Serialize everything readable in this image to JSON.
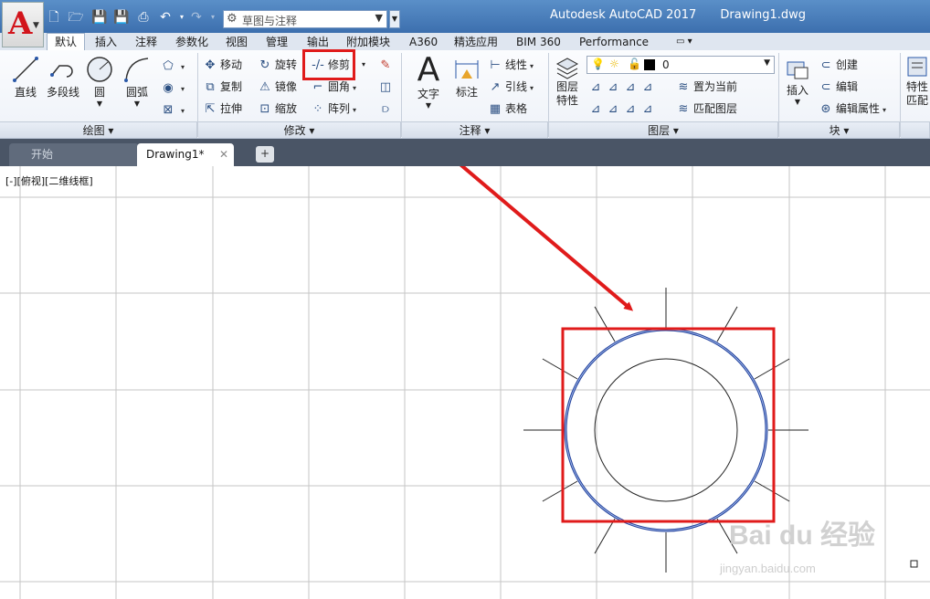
{
  "app": {
    "title": "Autodesk AutoCAD 2017",
    "document": "Drawing1.dwg"
  },
  "workspace": {
    "label": "草图与注释"
  },
  "ribbon_tabs": [
    "默认",
    "插入",
    "注释",
    "参数化",
    "视图",
    "管理",
    "输出",
    "附加模块",
    "A360",
    "精选应用",
    "BIM 360",
    "Performance"
  ],
  "panels": {
    "draw": {
      "title": "绘图",
      "line": "直线",
      "polyline": "多段线",
      "circle": "圆",
      "arc": "圆弧"
    },
    "modify": {
      "title": "修改",
      "move": "移动",
      "rotate": "旋转",
      "trim": "修剪",
      "copy": "复制",
      "mirror": "镜像",
      "fillet": "圆角",
      "stretch": "拉伸",
      "scale": "缩放",
      "array": "阵列"
    },
    "annotation": {
      "title": "注释",
      "text": "文字",
      "dimension": "标注",
      "linear": "线性",
      "leader": "引线",
      "table": "表格"
    },
    "layers": {
      "title": "图层",
      "properties_line1": "图层",
      "properties_line2": "特性",
      "current_layer": "0",
      "set_current": "置为当前",
      "match_layer": "匹配图层"
    },
    "block": {
      "title": "块",
      "insert": "插入",
      "create": "创建",
      "edit": "编辑",
      "edit_attributes": "编辑属性"
    },
    "properties": {
      "line1": "特性",
      "line2": "匹配"
    }
  },
  "doc_tabs": [
    "开始",
    "Drawing1*"
  ],
  "viewport_label": "[-][俯视][二维线框]",
  "colors": {
    "highlight": "#e01b1b",
    "title_bar": "#4a7fbf",
    "grid": "#b8b8b8",
    "selected_circle": "#1f3f9c"
  },
  "watermark": {
    "brand": "Bai du 经验",
    "url": "jingyan.baidu.com"
  }
}
